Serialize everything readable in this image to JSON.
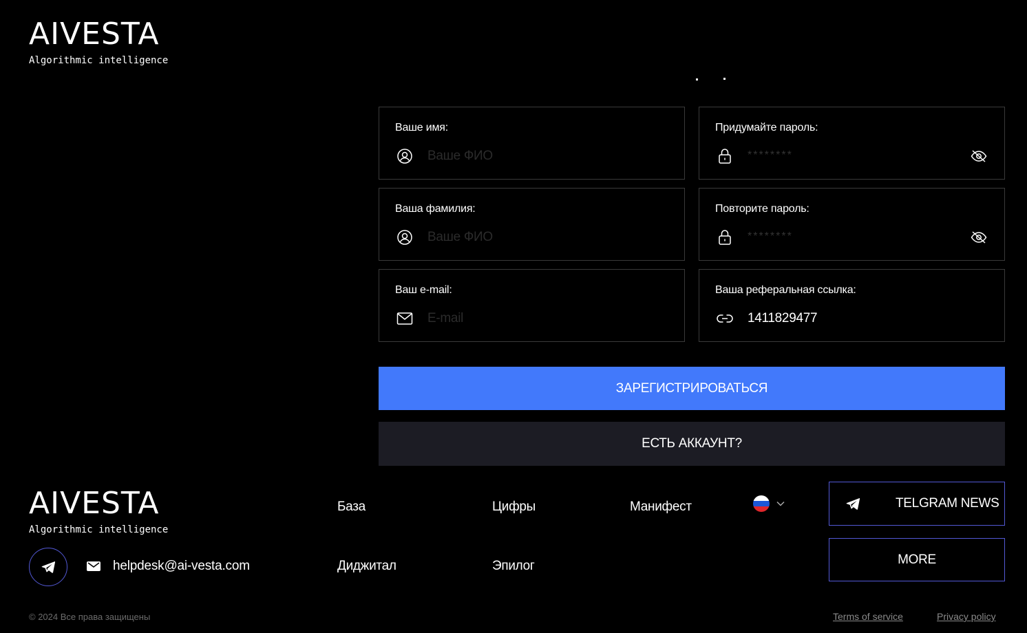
{
  "header": {
    "logo_title": "AIVESTA",
    "logo_subtitle": "Algorithmic intelligence"
  },
  "form": {
    "first_name": {
      "label": "Ваше имя:",
      "placeholder": "Ваше ФИО",
      "icon": "user-circle-icon"
    },
    "last_name": {
      "label": "Ваша фамилия:",
      "placeholder": "Ваше ФИО",
      "icon": "user-circle-icon"
    },
    "email": {
      "label": "Ваш e-mail:",
      "placeholder": "E-mail",
      "icon": "envelope-icon"
    },
    "password": {
      "label": "Придумайте пароль:",
      "placeholder": "********",
      "icon": "lock-icon",
      "toggle_icon": "eye-off-icon"
    },
    "password_repeat": {
      "label": "Повторите пароль:",
      "placeholder": "********",
      "icon": "lock-icon",
      "toggle_icon": "eye-off-icon"
    },
    "referral": {
      "label": "Ваша реферальная ссылка:",
      "value": "1411829477",
      "icon": "link-icon"
    },
    "register_label": "ЗАРЕГИСТРИРОВАТЬСЯ",
    "have_account_label": "ЕСТЬ АККАУНТ?"
  },
  "footer": {
    "logo_title": "AIVESTA",
    "logo_subtitle": "Algorithmic intelligence",
    "email": "helpdesk@ai-vesta.com",
    "nav": {
      "base": "База",
      "numbers": "Цифры",
      "manifest": "Манифест",
      "digital": "Диджитал",
      "epilogue": "Эпилог"
    },
    "language_flag": "russia-flag-icon",
    "telegram_news_label": "TELGRAM NEWS",
    "more_label": "MORE",
    "copyright": "© 2024 Все права защищены",
    "terms": "Terms of service",
    "privacy": "Privacy policy"
  },
  "colors": {
    "primary": "#4279fb",
    "secondary": "#1c1c24",
    "outline": "#5359d6",
    "field_border": "#3a3a3a"
  }
}
